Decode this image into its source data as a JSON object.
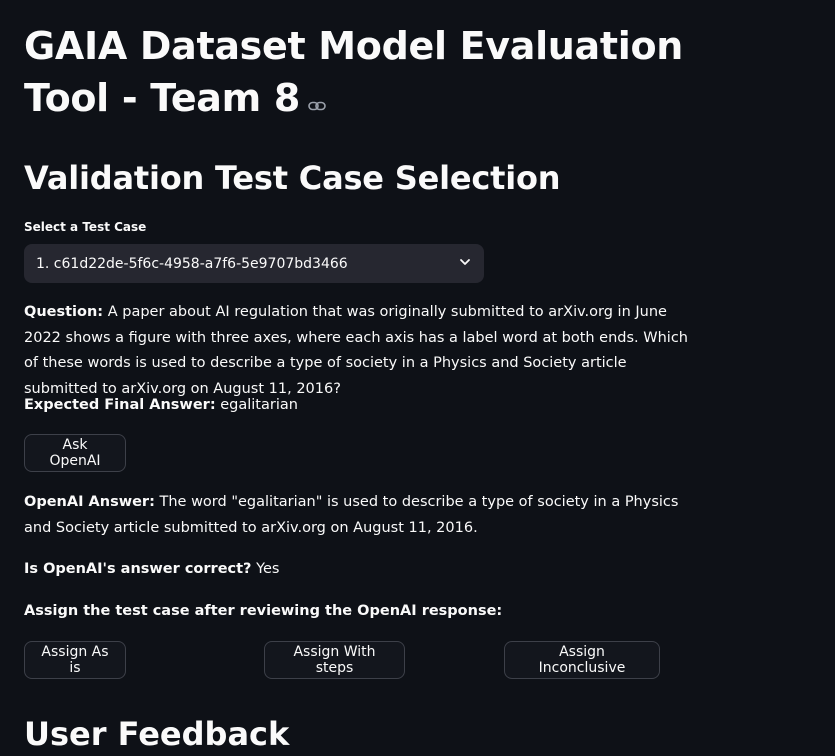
{
  "page": {
    "title": "GAIA Dataset Model Evaluation Tool - Team 8",
    "section_title": "Validation Test Case Selection",
    "feedback_title": "User Feedback"
  },
  "select": {
    "label": "Select a Test Case",
    "value": "1. c61d22de-5f6c-4958-a7f6-5e9707bd3466"
  },
  "question": {
    "label": "Question:",
    "text": " A paper about AI regulation that was originally submitted to arXiv.org in June 2022 shows a figure with three axes, where each axis has a label word at both ends. Which of these words is used to describe a type of society in a Physics and Society article submitted to arXiv.org on August 11, 2016?"
  },
  "expected": {
    "label": "Expected Final Answer:",
    "value": " egalitarian"
  },
  "ask_button": "Ask OpenAI",
  "openai_answer": {
    "label": "OpenAI Answer:",
    "text": " The word \"egalitarian\" is used to describe a type of society in a Physics and Society article submitted to arXiv.org on August 11, 2016."
  },
  "correctness": {
    "label": "Is OpenAI's answer correct?",
    "value": " Yes"
  },
  "assign": {
    "prompt": "Assign the test case after reviewing the OpenAI response:",
    "as_is": "Assign As is",
    "with_steps": "Assign With steps",
    "inconclusive": "Assign Inconclusive"
  }
}
